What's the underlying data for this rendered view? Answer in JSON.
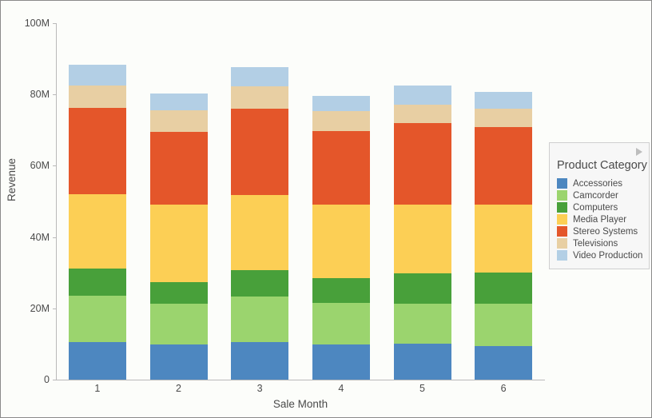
{
  "chart_data": {
    "type": "bar",
    "subtype": "stacked-bar",
    "title": "",
    "xlabel": "Sale Month",
    "ylabel": "Revenue",
    "categories": [
      "1",
      "2",
      "3",
      "4",
      "5",
      "6"
    ],
    "ylim": [
      0,
      100000000
    ],
    "ytick_labels": [
      "0",
      "20M",
      "40M",
      "60M",
      "80M",
      "100M"
    ],
    "ytick_values": [
      0,
      20000000,
      40000000,
      60000000,
      80000000,
      100000000
    ],
    "grid": false,
    "legend_position": "right",
    "legend_title": "Product Category",
    "units": "M",
    "series": [
      {
        "name": "Accessories",
        "color": "#4d87c0",
        "values": [
          10.5,
          9.9,
          10.5,
          9.9,
          10.1,
          9.4
        ]
      },
      {
        "name": "Camcorder",
        "color": "#9bd46e",
        "values": [
          13.0,
          11.4,
          12.8,
          11.7,
          11.2,
          11.9
        ]
      },
      {
        "name": "Computers",
        "color": "#48a03a",
        "values": [
          7.6,
          6.1,
          7.4,
          6.8,
          8.5,
          8.7
        ]
      },
      {
        "name": "Media Player",
        "color": "#fccf55",
        "values": [
          20.9,
          21.7,
          21.1,
          20.8,
          19.3,
          19.1
        ]
      },
      {
        "name": "Stereo Systems",
        "color": "#e4562a",
        "values": [
          24.2,
          20.4,
          24.2,
          20.6,
          22.9,
          21.8
        ]
      },
      {
        "name": "Televisions",
        "color": "#e8cfa3",
        "values": [
          6.3,
          6.0,
          6.3,
          5.6,
          5.1,
          5.1
        ]
      },
      {
        "name": "Video Production",
        "color": "#b3cfe5",
        "values": [
          5.8,
          4.7,
          5.4,
          4.3,
          5.4,
          4.7
        ]
      }
    ],
    "totals": [
      87.3,
      80.2,
      87.7,
      79.7,
      82.5,
      80.7
    ]
  },
  "axes": {
    "y": {
      "label": "Revenue",
      "ticks": [
        {
          "label": "0",
          "value": 0
        },
        {
          "label": "20M",
          "value": 20
        },
        {
          "label": "40M",
          "value": 40
        },
        {
          "label": "60M",
          "value": 60
        },
        {
          "label": "80M",
          "value": 80
        },
        {
          "label": "100M",
          "value": 100
        }
      ]
    },
    "x": {
      "label": "Sale Month",
      "ticks": [
        "1",
        "2",
        "3",
        "4",
        "5",
        "6"
      ]
    }
  },
  "legend": {
    "title": "Product Category",
    "collapse_icon": "triangle-right-icon",
    "items": [
      {
        "label": "Accessories",
        "color": "#4d87c0"
      },
      {
        "label": "Camcorder",
        "color": "#9bd46e"
      },
      {
        "label": "Computers",
        "color": "#48a03a"
      },
      {
        "label": "Media Player",
        "color": "#fccf55"
      },
      {
        "label": "Stereo Systems",
        "color": "#e4562a"
      },
      {
        "label": "Televisions",
        "color": "#e8cfa3"
      },
      {
        "label": "Video Production",
        "color": "#b3cfe5"
      }
    ]
  }
}
